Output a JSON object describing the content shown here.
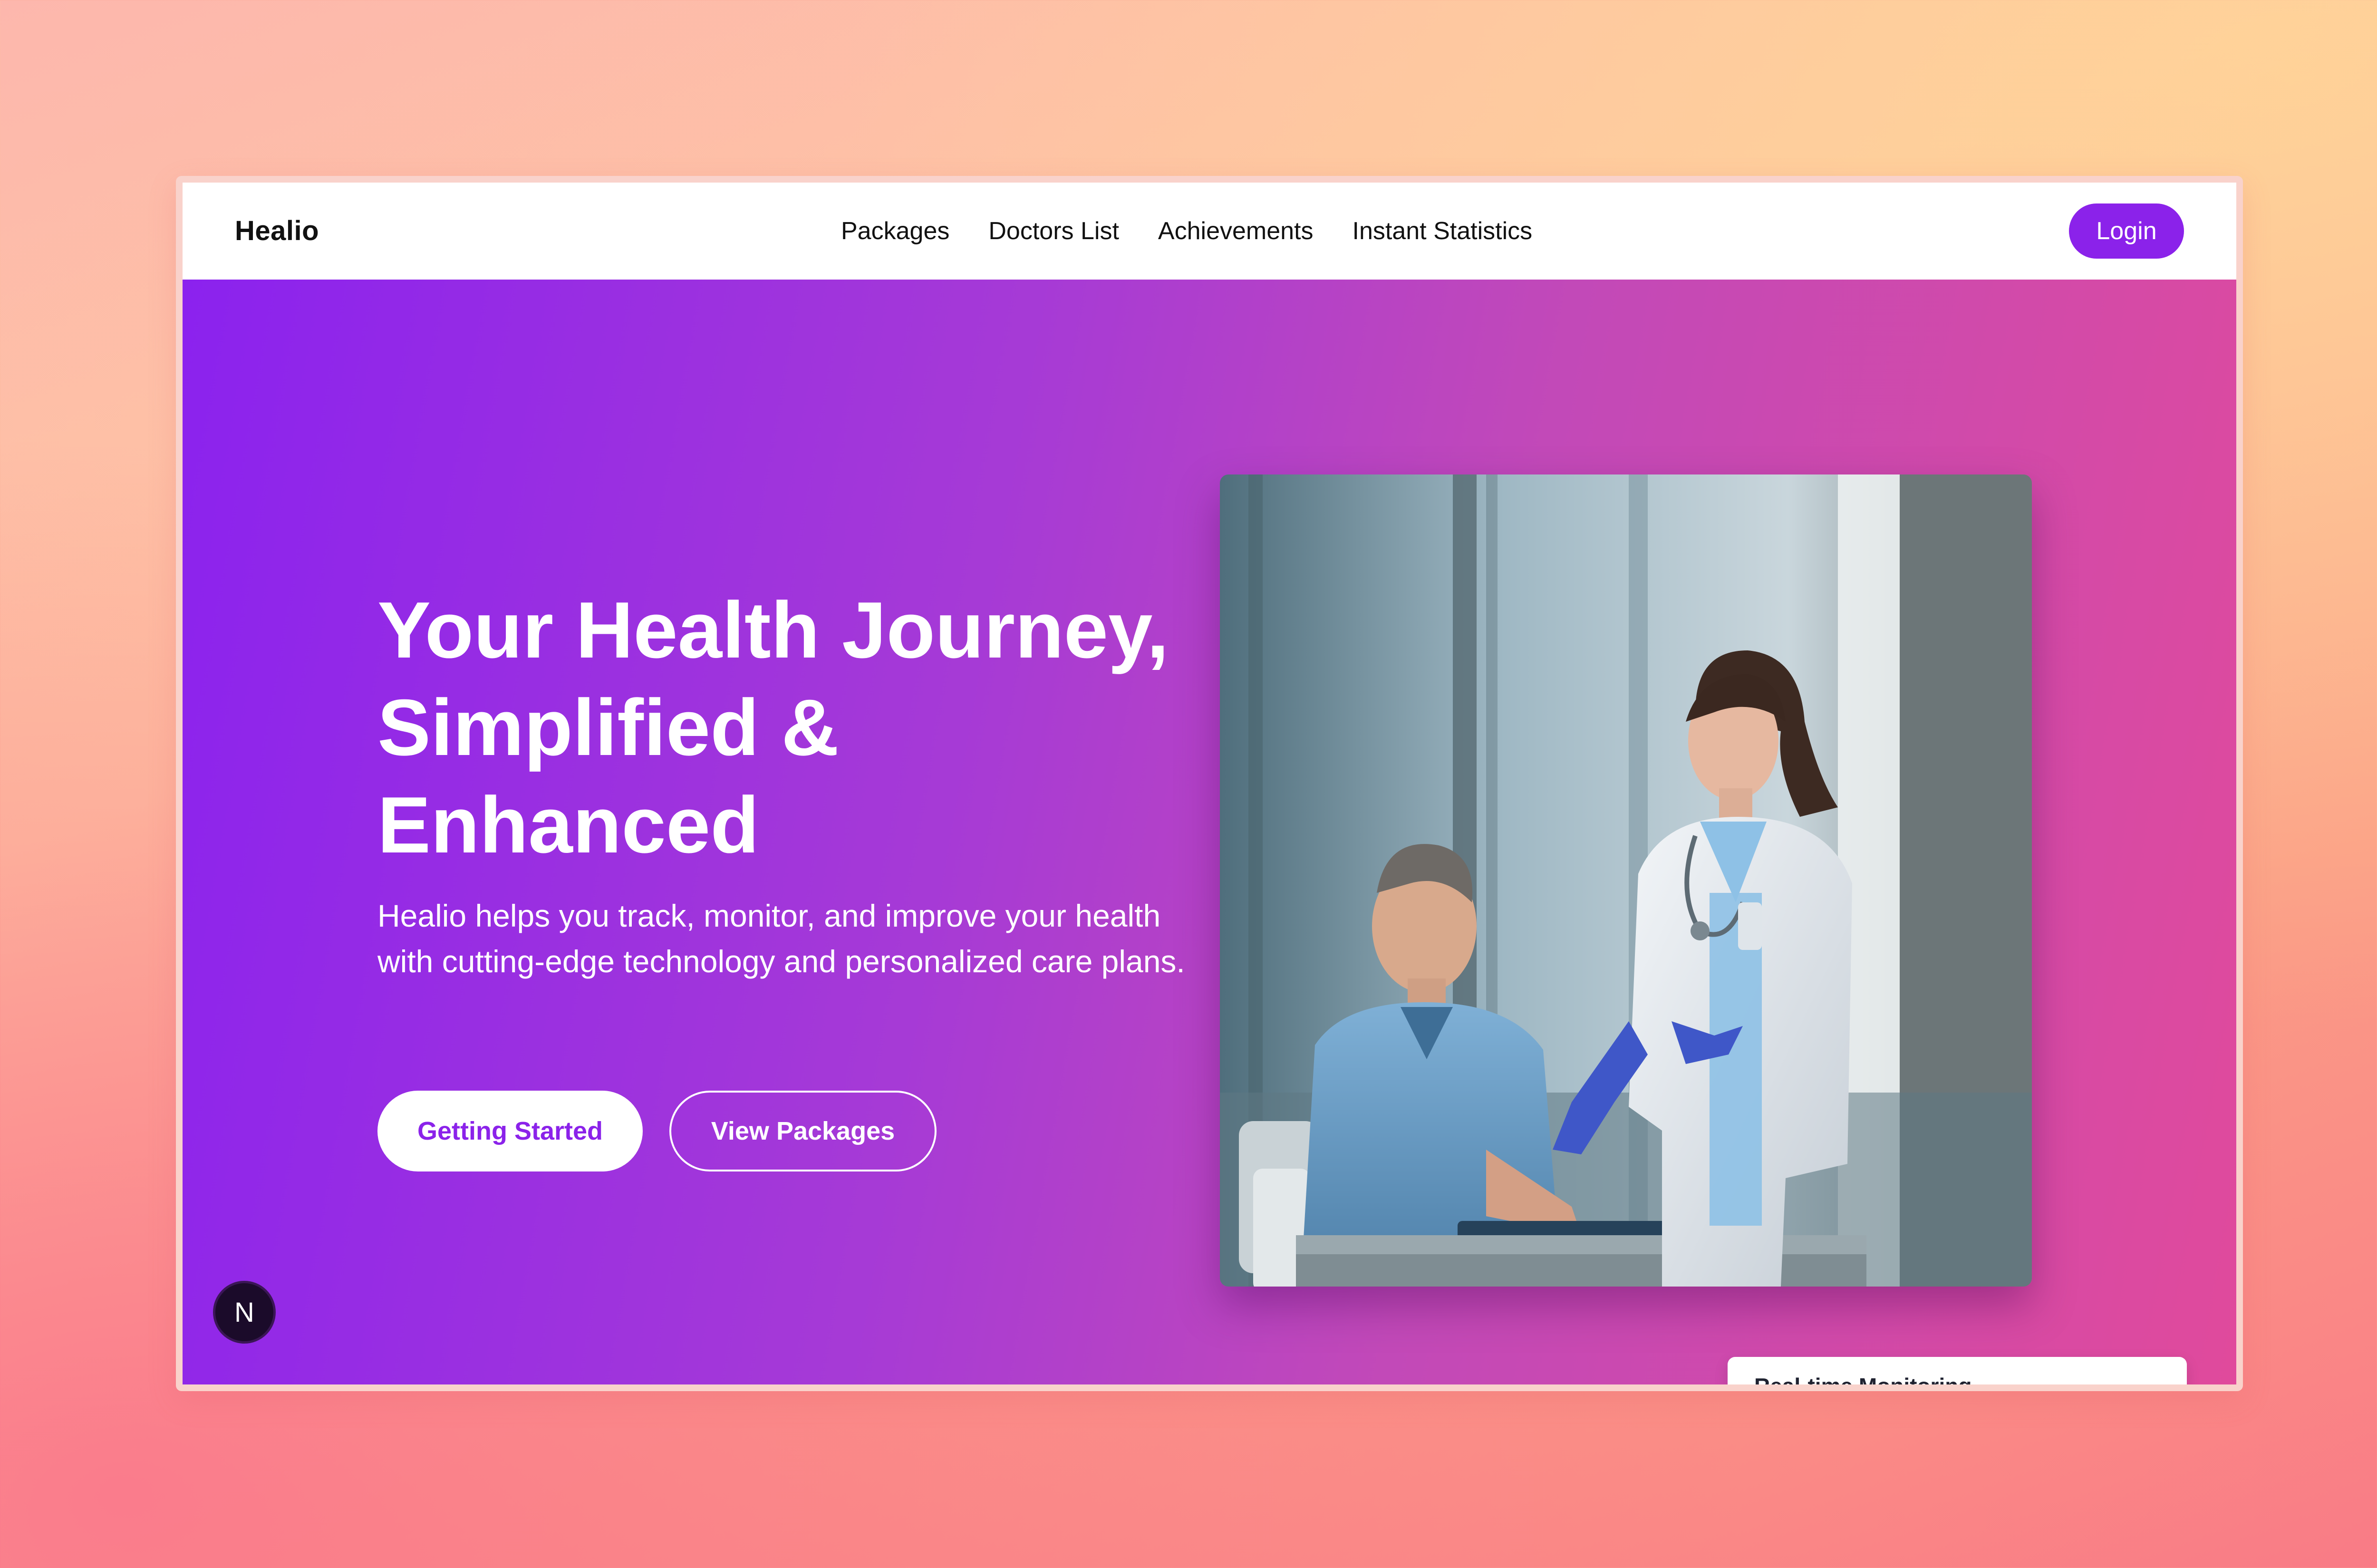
{
  "brand": {
    "name": "Healio"
  },
  "nav": {
    "links": [
      {
        "label": "Packages"
      },
      {
        "label": "Doctors List"
      },
      {
        "label": "Achievements"
      },
      {
        "label": "Instant Statistics"
      }
    ],
    "login_label": "Login"
  },
  "hero": {
    "title": "Your Health Journey, Simplified & Enhanced",
    "subtitle": "Healio helps you track, monitor, and improve your health with cutting-edge technology and personalized care plans.",
    "primary_button": "Getting Started",
    "secondary_button": "View Packages"
  },
  "badge": {
    "letter": "N"
  },
  "cards": {
    "monitoring_title": "Real-time Monitoring"
  },
  "colors": {
    "accent": "#8b22ea",
    "gradient_start": "#8b22ee",
    "gradient_end": "#e04a9c"
  }
}
